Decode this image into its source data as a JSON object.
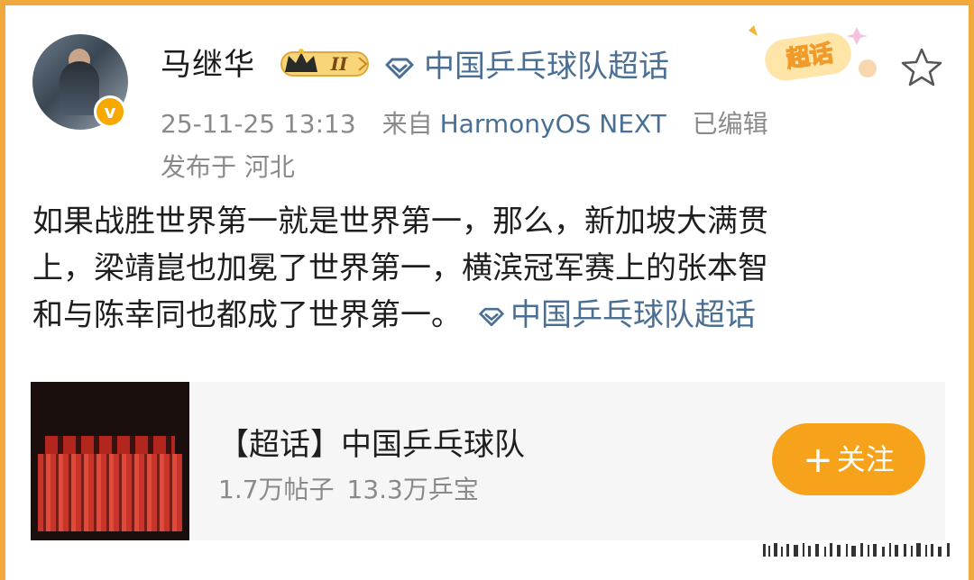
{
  "user": {
    "name": "马继华",
    "level_badge": "II",
    "verified_mark": "v"
  },
  "header": {
    "topic": "中国乒乓球队超话",
    "chaohua_label": "超话"
  },
  "meta": {
    "timestamp": "25-11-25 13:13",
    "source_prefix": "来自",
    "source": "HarmonyOS NEXT",
    "edited": "已编辑",
    "location": "发布于 河北"
  },
  "post": {
    "line1": "如果战胜世界第一就是世界第一，那么，新加坡大满贯",
    "line2": "上，梁靖崑也加冕了世界第一，横滨冠军赛上的张本智",
    "line3": "和与陈幸同也都成了世界第一。",
    "topic": "中国乒乓球队超话"
  },
  "card": {
    "title": "【超话】中国乒乓球队",
    "posts": "1.7万帖子",
    "fans": "13.3万乒宝",
    "follow_plus": "+",
    "follow_label": "关注"
  },
  "colors": {
    "link": "#4a6f94",
    "accent": "#f7a21b",
    "frame": "#f0a83c"
  }
}
